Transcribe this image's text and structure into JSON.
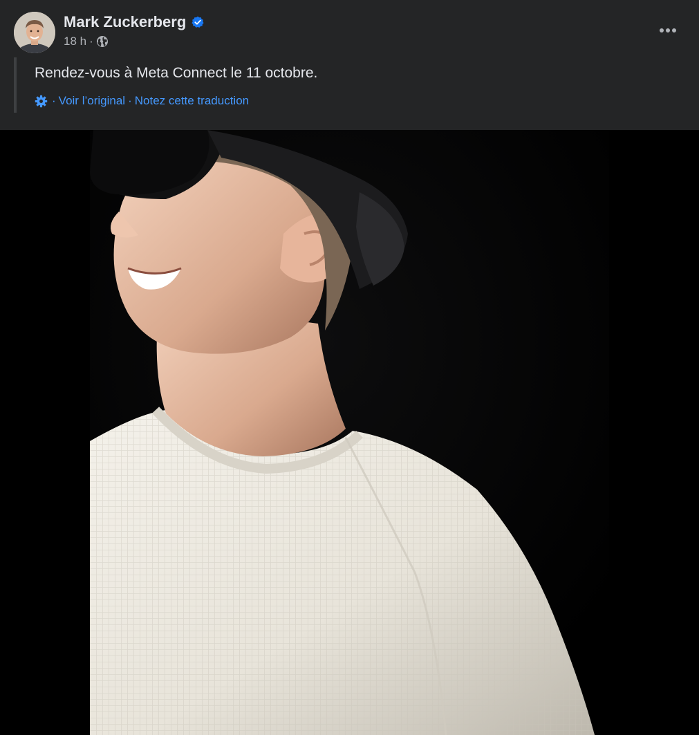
{
  "post": {
    "author": {
      "name": "Mark Zuckerberg",
      "verified": true,
      "avatar": "profile-photo"
    },
    "timestamp": "18 h",
    "separator": "·",
    "audience_icon": "globe-icon",
    "more_icon": "ellipsis-horizontal-icon",
    "text": "Rendez-vous à Meta Connect le 11 octobre.",
    "translation": {
      "icon": "gear-icon",
      "prefix_separator": "·",
      "view_original": "Voir l’original",
      "middle_separator": "·",
      "rate_translation": "Notez cette traduction"
    },
    "image": "photo-man-smiling-wearing-vr-headset-white-sweater"
  },
  "colors": {
    "card_background": "#242526",
    "primary_text": "#e4e6eb",
    "secondary_text": "#b0b3b8",
    "link": "#4599ff",
    "verified_badge": "#1877f2",
    "image_background": "#000000"
  }
}
